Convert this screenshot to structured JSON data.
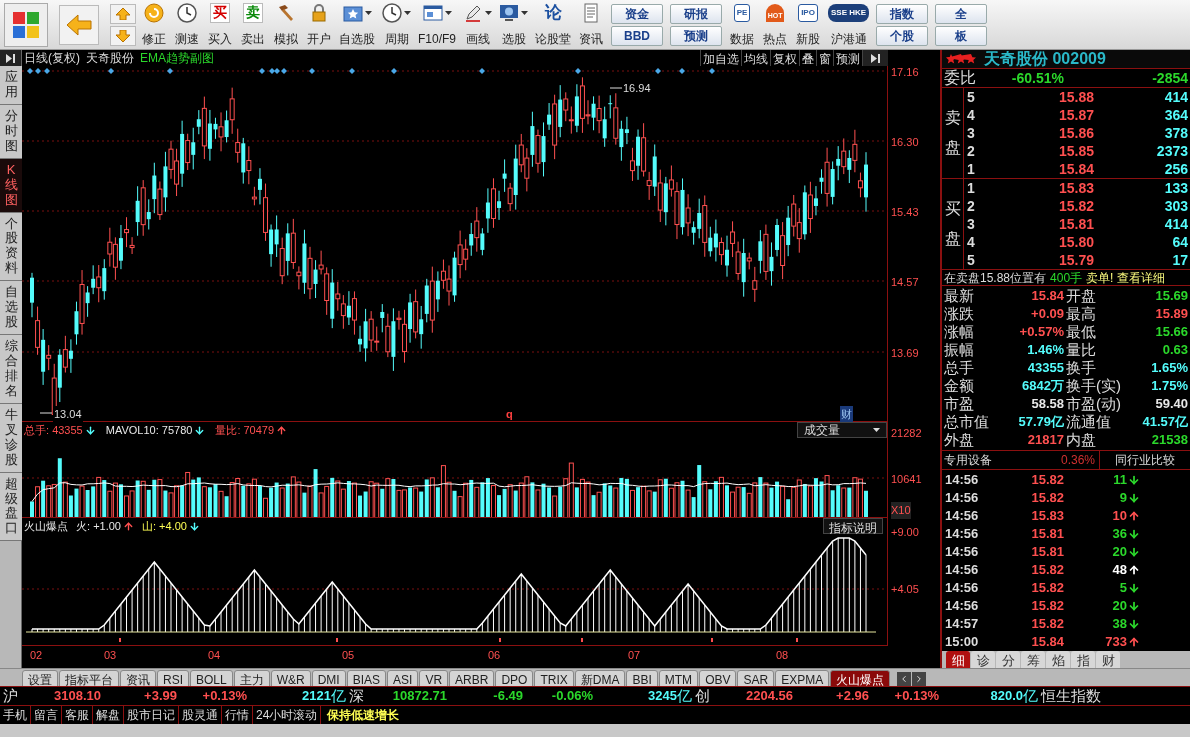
{
  "toolbar": {
    "items": [
      {
        "kind": "logo"
      },
      {
        "kind": "back"
      },
      {
        "kind": "updown"
      },
      {
        "kind": "fix",
        "label": "修正"
      },
      {
        "kind": "clock",
        "label": "测速"
      },
      {
        "kind": "glyph-red",
        "glyph": "买",
        "label": "买入"
      },
      {
        "kind": "glyph-green",
        "glyph": "卖",
        "label": "卖出"
      },
      {
        "kind": "hammer",
        "label": "模拟"
      },
      {
        "kind": "lock",
        "label": "开户"
      },
      {
        "kind": "star",
        "label": "自选股",
        "dropdown": true
      },
      {
        "kind": "clock",
        "label": "周期",
        "dropdown": true
      },
      {
        "kind": "window",
        "label": "F10/F9",
        "dropdown": true
      },
      {
        "kind": "pen",
        "label": "画线",
        "dropdown": true
      },
      {
        "kind": "monitor",
        "label": "选股",
        "dropdown": true
      },
      {
        "kind": "glyph-blue",
        "glyph": "论",
        "label": "论股堂"
      },
      {
        "kind": "doc",
        "label": "资讯"
      },
      {
        "kind": "pair",
        "labels": [
          "资金",
          "BBD"
        ]
      },
      {
        "kind": "pair",
        "labels": [
          "研报",
          "预测"
        ]
      },
      {
        "kind": "badge",
        "glyph": "PE",
        "label": "数据"
      },
      {
        "kind": "badge-hot",
        "glyph": "HOT",
        "label": "热点"
      },
      {
        "kind": "badge",
        "glyph": "IPO",
        "label": "新股"
      },
      {
        "kind": "badge-dark",
        "glyph": "SSE HKE",
        "label": "沪港通"
      },
      {
        "kind": "pair",
        "labels": [
          "指数",
          "个股"
        ]
      },
      {
        "kind": "pair",
        "labels": [
          "全",
          "板"
        ]
      }
    ]
  },
  "side_tabs": [
    {
      "label": "应用",
      "selected": false
    },
    {
      "label": "分时图",
      "selected": false
    },
    {
      "label": "K线图",
      "selected": true
    },
    {
      "label": "个股资料",
      "selected": false
    },
    {
      "label": "自选股",
      "selected": false
    },
    {
      "label": "综合排名",
      "selected": false
    },
    {
      "label": "牛叉诊股",
      "selected": false
    },
    {
      "label": "超级盘口",
      "selected": false
    }
  ],
  "chart_header": {
    "period": "日线(复权)",
    "stock": "天奇股份",
    "indicator": "EMA趋势副图",
    "buttons": [
      "加自选",
      "均线",
      "复权",
      "叠",
      "窗",
      "预测"
    ]
  },
  "price_axis": [
    "17.16",
    "16.30",
    "15.43",
    "14.57",
    "13.69"
  ],
  "high_label": "16.94",
  "low_label": "13.04",
  "event_markers": [
    "q",
    "财"
  ],
  "volume_header": [
    {
      "label": "总手:",
      "value": "43355",
      "rising": false,
      "color": "#ff5050"
    },
    {
      "label": "MAVOL10:",
      "value": "75780",
      "rising": false,
      "color": "#e8e8e8"
    },
    {
      "label": "量比:",
      "value": "70479",
      "rising": true,
      "color": "#ff5050"
    }
  ],
  "volume_dropdown": "成交量",
  "volume_axis": [
    "21282",
    "10641",
    "X10"
  ],
  "indicator_header": {
    "name": "火山爆点",
    "lines": [
      {
        "label": "火:",
        "value": "+1.00",
        "rising": true,
        "color": "#e8e8e8"
      },
      {
        "label": "山:",
        "value": "+4.00",
        "rising": false,
        "color": "#ffff54"
      }
    ]
  },
  "indicator_button": "指标说明",
  "indicator_axis": [
    "+9.00",
    "+4.05"
  ],
  "months": [
    "02",
    "03",
    "04",
    "05",
    "06",
    "07",
    "08"
  ],
  "bottom_tabs": [
    {
      "label": "设置",
      "selected": false
    },
    {
      "label": "指标平台",
      "selected": false
    },
    {
      "label": "资讯",
      "selected": false
    },
    {
      "label": "RSI",
      "selected": false
    },
    {
      "label": "BOLL",
      "selected": false
    },
    {
      "label": "主力",
      "selected": false
    },
    {
      "label": "W&R",
      "selected": false
    },
    {
      "label": "DMI",
      "selected": false
    },
    {
      "label": "BIAS",
      "selected": false
    },
    {
      "label": "ASI",
      "selected": false
    },
    {
      "label": "VR",
      "selected": false
    },
    {
      "label": "ARBR",
      "selected": false
    },
    {
      "label": "DPO",
      "selected": false
    },
    {
      "label": "TRIX",
      "selected": false
    },
    {
      "label": "新DMA",
      "selected": false
    },
    {
      "label": "BBI",
      "selected": false
    },
    {
      "label": "MTM",
      "selected": false
    },
    {
      "label": "OBV",
      "selected": false
    },
    {
      "label": "SAR",
      "selected": false
    },
    {
      "label": "EXPMA",
      "selected": false
    },
    {
      "label": "火山爆点",
      "selected": true
    }
  ],
  "quote": {
    "title": "天奇股份 002009",
    "ratio_label": "委比",
    "ratio_pct": "-60.51%",
    "ratio_diff": "-2854",
    "sell_label": "卖盘",
    "sell": [
      {
        "level": "5",
        "price": "15.88",
        "volume": "414"
      },
      {
        "level": "4",
        "price": "15.87",
        "volume": "364"
      },
      {
        "level": "3",
        "price": "15.86",
        "volume": "378"
      },
      {
        "level": "2",
        "price": "15.85",
        "volume": "2373"
      },
      {
        "level": "1",
        "price": "15.84",
        "volume": "256"
      }
    ],
    "buy_label": "买盘",
    "buy": [
      {
        "level": "1",
        "price": "15.83",
        "volume": "133"
      },
      {
        "level": "2",
        "price": "15.82",
        "volume": "303"
      },
      {
        "level": "3",
        "price": "15.81",
        "volume": "414"
      },
      {
        "level": "4",
        "price": "15.80",
        "volume": "64"
      },
      {
        "level": "5",
        "price": "15.79",
        "volume": "17"
      }
    ],
    "notice": {
      "text": "在卖盘15.88位置有",
      "amount": "400手",
      "link": "卖单! 查看详细"
    },
    "stats": [
      {
        "cells": [
          {
            "label": "最新",
            "value": "15.84",
            "color": "#ff5050"
          },
          {
            "label": "开盘",
            "value": "15.69",
            "color": "#2bd82b"
          }
        ]
      },
      {
        "cells": [
          {
            "label": "涨跌",
            "value": "+0.09",
            "color": "#ff5050"
          },
          {
            "label": "最高",
            "value": "15.89",
            "color": "#ff5050"
          }
        ]
      },
      {
        "cells": [
          {
            "label": "涨幅",
            "value": "+0.57%",
            "color": "#ff5050"
          },
          {
            "label": "最低",
            "value": "15.66",
            "color": "#2bd82b"
          }
        ]
      },
      {
        "cells": [
          {
            "label": "振幅",
            "value": "1.46%",
            "color": "#54fcfc"
          },
          {
            "label": "量比",
            "value": "0.63",
            "color": "#2bd82b"
          }
        ]
      },
      {
        "cells": [
          {
            "label": "总手",
            "value": "43355",
            "color": "#54fcfc"
          },
          {
            "label": "换手",
            "value": "1.65%",
            "color": "#54fcfc"
          }
        ]
      },
      {
        "cells": [
          {
            "label": "金额",
            "value": "6842万",
            "color": "#54fcfc"
          },
          {
            "label": "换手(实)",
            "value": "1.75%",
            "color": "#54fcfc"
          }
        ]
      },
      {
        "cells": [
          {
            "label": "市盈",
            "value": "58.58",
            "color": "#e8e8e8"
          },
          {
            "label": "市盈(动)",
            "value": "59.40",
            "color": "#e8e8e8"
          }
        ]
      },
      {
        "cells": [
          {
            "label": "总市值",
            "value": "57.79亿",
            "color": "#54fcfc"
          },
          {
            "label": "流通值",
            "value": "41.57亿",
            "color": "#54fcfc"
          }
        ]
      },
      {
        "cells": [
          {
            "label": "外盘",
            "value": "21817",
            "color": "#ff5050"
          },
          {
            "label": "内盘",
            "value": "21538",
            "color": "#2bd82b"
          }
        ]
      }
    ],
    "industry": {
      "name": "专用设备",
      "pct": "0.36%",
      "button": "同行业比较"
    },
    "trades": [
      {
        "time": "14:56",
        "price": "15.82",
        "volume": "11",
        "rising": false,
        "color": "#2bd82b"
      },
      {
        "time": "14:56",
        "price": "15.82",
        "volume": "9",
        "rising": false,
        "color": "#2bd82b"
      },
      {
        "time": "14:56",
        "price": "15.83",
        "volume": "10",
        "rising": true,
        "color": "#ff5050"
      },
      {
        "time": "14:56",
        "price": "15.81",
        "volume": "36",
        "rising": false,
        "color": "#2bd82b"
      },
      {
        "time": "14:56",
        "price": "15.81",
        "volume": "20",
        "rising": false,
        "color": "#2bd82b"
      },
      {
        "time": "14:56",
        "price": "15.82",
        "volume": "48",
        "rising": true,
        "color": "#ffffff"
      },
      {
        "time": "14:56",
        "price": "15.82",
        "volume": "5",
        "rising": false,
        "color": "#2bd82b"
      },
      {
        "time": "14:56",
        "price": "15.82",
        "volume": "20",
        "rising": false,
        "color": "#2bd82b"
      },
      {
        "time": "14:57",
        "price": "15.82",
        "volume": "38",
        "rising": false,
        "color": "#2bd82b"
      },
      {
        "time": "15:00",
        "price": "15.84",
        "volume": "733",
        "rising": true,
        "color": "#ff5050"
      }
    ],
    "tabs": [
      {
        "label": "细",
        "selected": true
      },
      {
        "label": "诊",
        "selected": false
      },
      {
        "label": "分",
        "selected": false
      },
      {
        "label": "筹",
        "selected": false
      },
      {
        "label": "焰",
        "selected": false
      },
      {
        "label": "指",
        "selected": false
      },
      {
        "label": "财",
        "selected": false
      }
    ]
  },
  "index_bar": [
    {
      "name": "沪",
      "value": "3108.10",
      "change": "+3.99",
      "pct": "+0.13%",
      "amount": "2121",
      "unit": "亿",
      "rising": true
    },
    {
      "name": "深",
      "value": "10872.71",
      "change": "-6.49",
      "pct": "-0.06%",
      "amount": "3245",
      "unit": "亿",
      "rising": false
    },
    {
      "name": "创",
      "value": "2204.56",
      "change": "+2.96",
      "pct": "+0.13%",
      "amount": "820.0",
      "unit": "亿",
      "rising": true
    },
    {
      "name": "恒生指数"
    }
  ],
  "news_bar": {
    "links": [
      "手机",
      "留言",
      "客服",
      "解盘",
      "股市日记",
      "股灵通",
      "行情",
      "24小时滚动"
    ],
    "headline": "保持低速增长"
  }
}
